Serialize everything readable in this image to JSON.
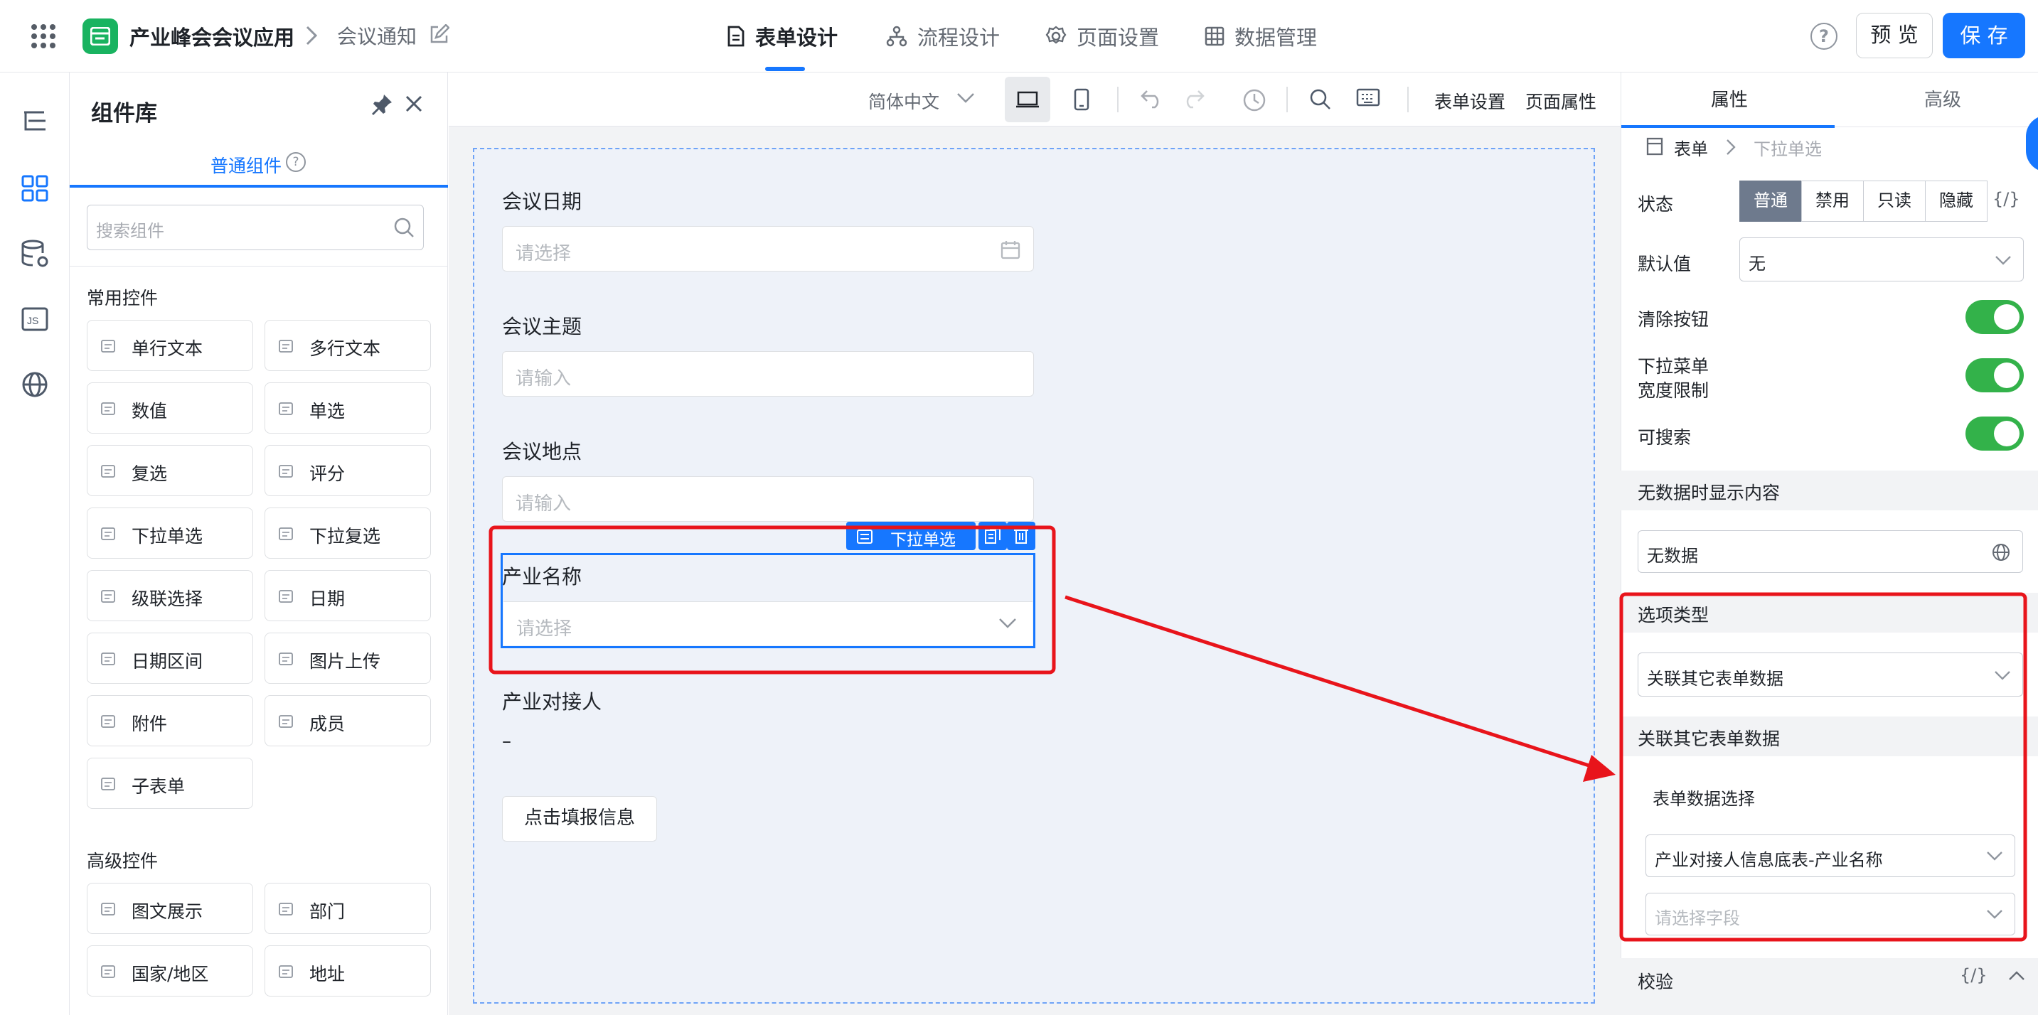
{
  "header": {
    "app_name": "产业峰会会议应用",
    "page_name": "会议通知",
    "tabs": [
      "表单设计",
      "流程设计",
      "页面设置",
      "数据管理"
    ],
    "preview_label": "预 览",
    "save_label": "保 存",
    "accent": "#1677ff",
    "logo_color": "#19b360"
  },
  "library": {
    "title": "组件库",
    "tab": "普通组件",
    "search_placeholder": "搜索组件",
    "common_section": "常用控件",
    "common_items": [
      {
        "label": "单行文本",
        "icon": "single-line-text-icon"
      },
      {
        "label": "多行文本",
        "icon": "multi-line-text-icon"
      },
      {
        "label": "数值",
        "icon": "number-icon"
      },
      {
        "label": "单选",
        "icon": "radio-icon"
      },
      {
        "label": "复选",
        "icon": "checkbox-icon"
      },
      {
        "label": "评分",
        "icon": "star-icon"
      },
      {
        "label": "下拉单选",
        "icon": "dropdown-icon"
      },
      {
        "label": "下拉复选",
        "icon": "dropdown-multi-icon"
      },
      {
        "label": "级联选择",
        "icon": "cascade-icon"
      },
      {
        "label": "日期",
        "icon": "calendar-icon"
      },
      {
        "label": "日期区间",
        "icon": "date-range-icon"
      },
      {
        "label": "图片上传",
        "icon": "image-icon"
      },
      {
        "label": "附件",
        "icon": "attachment-icon"
      },
      {
        "label": "成员",
        "icon": "member-icon"
      },
      {
        "label": "子表单",
        "icon": "subform-icon"
      }
    ],
    "advanced_section": "高级控件",
    "advanced_items": [
      {
        "label": "图文展示",
        "icon": "rich-text-icon"
      },
      {
        "label": "部门",
        "icon": "department-icon"
      },
      {
        "label": "国家/地区",
        "icon": "globe-icon"
      },
      {
        "label": "地址",
        "icon": "map-icon"
      }
    ]
  },
  "toolbar": {
    "language": "简体中文",
    "form_settings": "表单设置",
    "page_props": "页面属性"
  },
  "form": {
    "fields": [
      {
        "label": "会议日期",
        "placeholder": "请选择"
      },
      {
        "label": "会议主题",
        "placeholder": "请输入"
      },
      {
        "label": "会议地点",
        "placeholder": "请输入"
      },
      {
        "label": "产业名称",
        "placeholder": "请选择"
      },
      {
        "label": "产业对接人",
        "value": "–"
      }
    ],
    "selected_tag": "下拉单选",
    "button_label": "点击填报信息"
  },
  "props": {
    "tabs": [
      "属性",
      "高级"
    ],
    "crumb_root": "表单",
    "crumb_current": "下拉单选",
    "state_label": "状态",
    "state_options": [
      "普通",
      "禁用",
      "只读",
      "隐藏"
    ],
    "state_selected": "普通",
    "code_mark": "{/}",
    "default_label": "默认值",
    "default_value": "无",
    "clear_label": "清除按钮",
    "width_label_1": "下拉菜单",
    "width_label_2": "宽度限制",
    "search_label": "可搜索",
    "empty_section": "无数据时显示内容",
    "empty_value": "无数据",
    "option_type_section": "选项类型",
    "option_type_value": "关联其它表单数据",
    "linked_section": "关联其它表单数据",
    "form_select_label": "表单数据选择",
    "form_select_value": "产业对接人信息底表-产业名称",
    "field_placeholder": "请选择字段",
    "validate_section": "校验",
    "toggle_color": "#33b24a",
    "annotation_color": "#e8141b"
  }
}
